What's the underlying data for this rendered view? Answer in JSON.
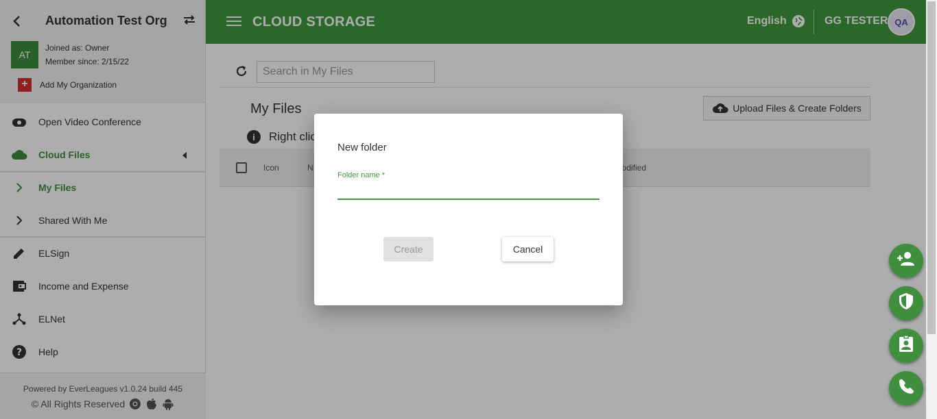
{
  "sidebar": {
    "org_name": "Automation Test Org",
    "avatar_initials": "AT",
    "joined_as": "Joined as: Owner",
    "member_since": "Member since: 2/15/22",
    "add_org_label": "Add My Organization",
    "items": [
      {
        "label": "Open Video Conference",
        "icon": "video-conference-icon"
      },
      {
        "label": "Cloud Files",
        "icon": "cloud-icon",
        "active": true
      },
      {
        "label": "My Files",
        "icon": "chevron-right-icon",
        "active": true
      },
      {
        "label": "Shared With Me",
        "icon": "chevron-right-icon"
      },
      {
        "label": "ELSign",
        "icon": "pencil-icon"
      },
      {
        "label": "Income and Expense",
        "icon": "wallet-icon"
      },
      {
        "label": "ELNet",
        "icon": "network-icon"
      },
      {
        "label": "Help",
        "icon": "help-icon"
      }
    ],
    "footer_powered": "Powered by EverLeagues v1.0.24 build 445",
    "footer_rights": "© All Rights Reserved"
  },
  "header": {
    "title": "CLOUD STORAGE",
    "language": "English",
    "user_name": "GG TESTER",
    "user_avatar_text": "QA",
    "accent_color": "#3f9a3f"
  },
  "main": {
    "search_placeholder": "Search in My Files",
    "page_title": "My Files",
    "upload_button": "Upload Files & Create Folders",
    "info_text": "Right clic",
    "columns": {
      "icon": "Icon",
      "name": "N",
      "modified": "t Modified"
    }
  },
  "dialog": {
    "title": "New folder",
    "field_label": "Folder name *",
    "field_value": "",
    "create_label": "Create",
    "cancel_label": "Cancel"
  },
  "fabs": [
    "add-person-icon",
    "shield-icon",
    "contact-badge-icon",
    "contact-phone-icon"
  ]
}
